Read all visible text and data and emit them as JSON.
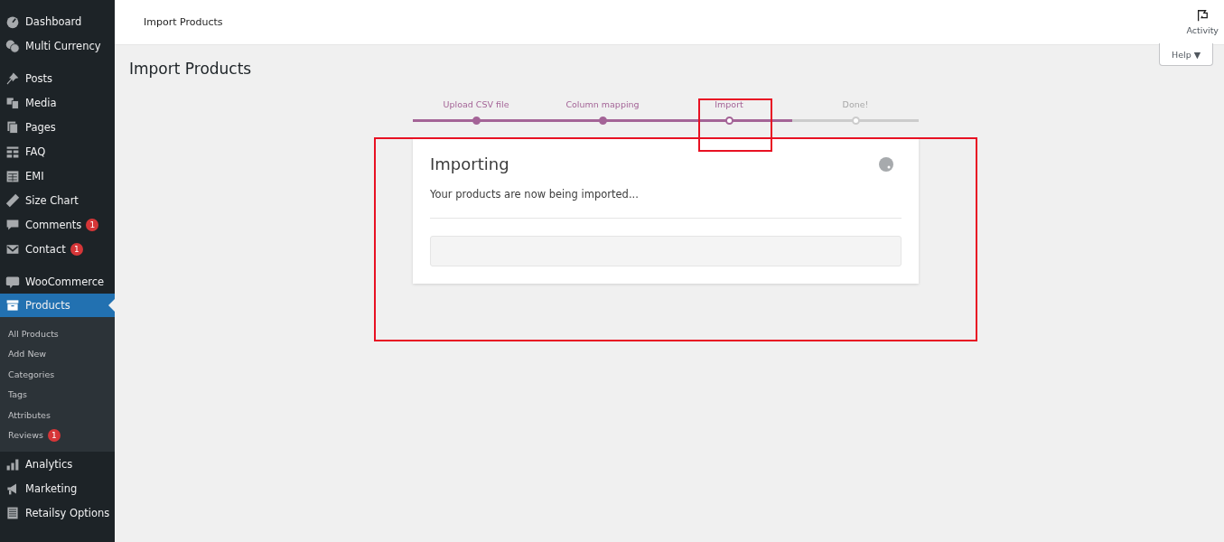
{
  "sidebar": {
    "groups": [
      {
        "items": [
          {
            "label": "Dashboard",
            "selected": false
          },
          {
            "label": "Multi Currency",
            "selected": false
          }
        ]
      },
      {
        "items": [
          {
            "label": "Posts",
            "selected": false
          },
          {
            "label": "Media",
            "selected": false
          },
          {
            "label": "Pages",
            "selected": false
          },
          {
            "label": "FAQ",
            "selected": false
          },
          {
            "label": "EMI",
            "selected": false
          },
          {
            "label": "Size Chart",
            "selected": false
          },
          {
            "label": "Comments",
            "selected": false,
            "badge": "1"
          },
          {
            "label": "Contact",
            "selected": false,
            "badge": "1"
          }
        ]
      },
      {
        "items": [
          {
            "label": "WooCommerce",
            "selected": false
          },
          {
            "label": "Products",
            "selected": true,
            "children": [
              {
                "label": "All Products",
                "selected": false
              },
              {
                "label": "Add New",
                "selected": false
              },
              {
                "label": "Categories",
                "selected": false
              },
              {
                "label": "Tags",
                "selected": false
              },
              {
                "label": "Attributes",
                "selected": false
              },
              {
                "label": "Reviews",
                "selected": false,
                "badge": "1"
              }
            ]
          },
          {
            "label": "Analytics",
            "selected": false
          },
          {
            "label": "Marketing",
            "selected": false
          },
          {
            "label": "Retailsy Options",
            "selected": false
          }
        ]
      }
    ]
  },
  "topbar": {
    "title": "Import Products",
    "activity": "Activity"
  },
  "help_button": "Help ▼",
  "page_title": "Import Products",
  "steps": [
    {
      "label": "Upload CSV file",
      "done": true,
      "selected": false
    },
    {
      "label": "Column mapping",
      "done": true,
      "selected": false
    },
    {
      "label": "Import",
      "done": false,
      "selected": true
    },
    {
      "label": "Done!",
      "done": false,
      "selected": false
    }
  ],
  "card": {
    "title": "Importing",
    "message": "Your products are now being imported...",
    "progress": {
      "level": 0
    }
  }
}
